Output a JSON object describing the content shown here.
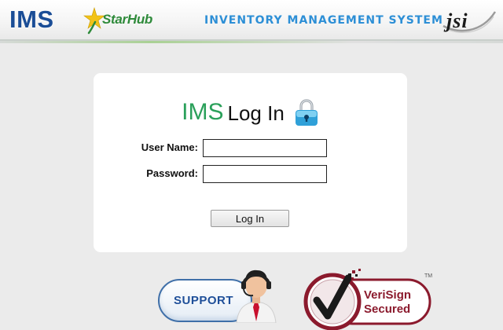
{
  "header": {
    "ims_logo": "IMS",
    "partner_logo": "StarHub",
    "system_title": "INVENTORY MANAGEMENT SYSTEM",
    "jsi_logo": "jsi"
  },
  "login": {
    "title_brand": "IMS",
    "title_text": "Log In",
    "lock_icon": "lock-icon",
    "username_label": "User Name:",
    "username_value": "",
    "password_label": "Password:",
    "password_value": "",
    "submit_label": "Log In"
  },
  "footer": {
    "support_label": "SUPPORT",
    "support_icon": "customer-support-agent-icon",
    "verisign_line1": "VeriSign",
    "verisign_line2": "Secured",
    "verisign_tm": "TM"
  },
  "colors": {
    "ims_blue": "#1a4d96",
    "brand_green": "#2aa05a",
    "title_blue": "#2d8fd6",
    "verisign_maroon": "#8b1a2d",
    "page_background": "#ebebeb"
  }
}
